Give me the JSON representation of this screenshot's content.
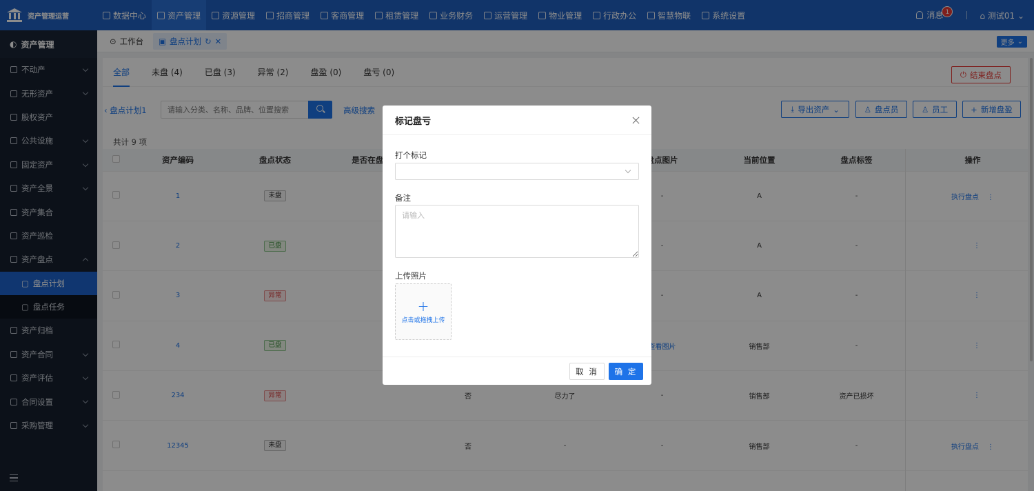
{
  "app": {
    "title": "资产管理运营"
  },
  "nav": [
    {
      "label": "数据中心",
      "active": false
    },
    {
      "label": "资产管理",
      "active": true
    },
    {
      "label": "资源管理",
      "active": false
    },
    {
      "label": "招商管理",
      "active": false
    },
    {
      "label": "客商管理",
      "active": false
    },
    {
      "label": "租赁管理",
      "active": false
    },
    {
      "label": "业务财务",
      "active": false
    },
    {
      "label": "运营管理",
      "active": false
    },
    {
      "label": "物业管理",
      "active": false
    },
    {
      "label": "行政办公",
      "active": false
    },
    {
      "label": "智慧物联",
      "active": false
    },
    {
      "label": "系统设置",
      "active": false
    }
  ],
  "top_right": {
    "messages_label": "消息",
    "messages_count": "1",
    "user_label": "测试01"
  },
  "sidebar": {
    "header": "资产管理",
    "items": [
      {
        "label": "不动产",
        "chevron": "down"
      },
      {
        "label": "无形资产",
        "chevron": "down"
      },
      {
        "label": "股权资产",
        "chevron": ""
      },
      {
        "label": "公共设施",
        "chevron": "down"
      },
      {
        "label": "固定资产",
        "chevron": "down"
      },
      {
        "label": "资产全景",
        "chevron": "down"
      },
      {
        "label": "资产集合",
        "chevron": ""
      },
      {
        "label": "资产巡检",
        "chevron": ""
      },
      {
        "label": "资产盘点",
        "chevron": "up"
      }
    ],
    "subitems": [
      {
        "label": "盘点计划",
        "active": true
      },
      {
        "label": "盘点任务",
        "active": false
      }
    ],
    "items_after": [
      {
        "label": "资产归档",
        "chevron": ""
      },
      {
        "label": "资产合同",
        "chevron": "down"
      },
      {
        "label": "资产评估",
        "chevron": "down"
      },
      {
        "label": "合同设置",
        "chevron": "down"
      },
      {
        "label": "采购管理",
        "chevron": "down"
      }
    ]
  },
  "page_tabs": {
    "workbench": "工作台",
    "current": "盘点计划",
    "more": "更多"
  },
  "filters": {
    "tabs": [
      "全部",
      "未盘 (4)",
      "已盘 (3)",
      "异常 (2)",
      "盘盈 (0)",
      "盘亏 (0)"
    ],
    "end_button": "结束盘点"
  },
  "toolbar": {
    "back_link": "盘点计划1",
    "search_placeholder": "请输入分类、名称、品牌、位置搜索",
    "advanced": "高级搜索",
    "export": "导出资产",
    "counter": "盘点员",
    "employee": "员工",
    "add": "新增盘盈"
  },
  "table": {
    "total": "共计 9 项",
    "columns": [
      "资产编码",
      "盘点状态",
      "是否在盘点",
      "",
      "",
      "盘点图片",
      "当前位置",
      "盘点标签",
      "",
      "操作"
    ],
    "rows": [
      {
        "code": "1",
        "status": "未盘",
        "status_color": "gray",
        "c4": "",
        "c5": "",
        "image": "-",
        "location": "A",
        "label": "-",
        "op": "执行盘点"
      },
      {
        "code": "2",
        "status": "已盘",
        "status_color": "green",
        "c4": "",
        "c5": "",
        "image": "-",
        "location": "A",
        "label": "-",
        "op": ""
      },
      {
        "code": "3",
        "status": "异常",
        "status_color": "red",
        "c4": "",
        "c5": "",
        "image": "-",
        "location": "A",
        "label": "-",
        "op": ""
      },
      {
        "code": "4",
        "status": "已盘",
        "status_color": "green",
        "c4": "",
        "c5": "",
        "image": "查看图片",
        "location": "销售部",
        "label": "-",
        "op": ""
      },
      {
        "code": "234",
        "status": "异常",
        "status_color": "red",
        "c4": "否",
        "c5": "尽力了",
        "image": "-",
        "location": "销售部",
        "label": "资产已损坏",
        "op": ""
      },
      {
        "code": "12345",
        "status": "未盘",
        "status_color": "gray",
        "c4": "否",
        "c5": "-",
        "image": "-",
        "location": "销售部",
        "label": "-",
        "op": "执行盘点"
      }
    ]
  },
  "modal": {
    "title": "标记盘亏",
    "mark_label": "打个标记",
    "mark_value": "",
    "remark_label": "备注",
    "remark_placeholder": "请输入",
    "upload_label": "上传照片",
    "upload_text": "点击或拖拽上传",
    "cancel": "取 消",
    "ok": "确 定"
  },
  "colors": {
    "primary": "#1e73e8",
    "topbar": "#1f5fbf",
    "sidebar": "#16202f",
    "danger": "#e53935"
  }
}
